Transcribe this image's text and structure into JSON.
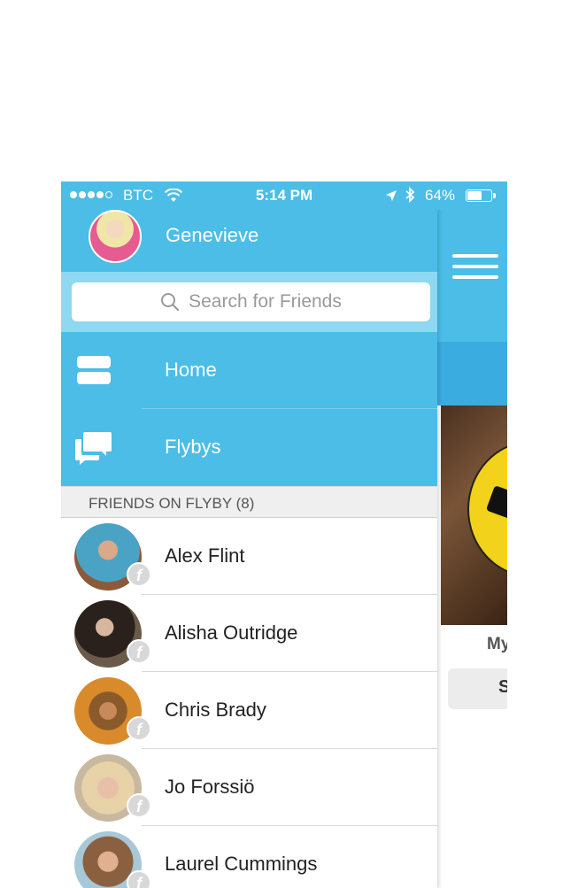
{
  "status_bar": {
    "carrier": "BTC",
    "time": "5:14 PM",
    "battery_percent": "64%",
    "battery_level": 0.64
  },
  "profile": {
    "name": "Genevieve"
  },
  "search": {
    "placeholder": "Search for Friends"
  },
  "menu": {
    "items": [
      {
        "label": "Home",
        "icon": "home-icon"
      },
      {
        "label": "Flybys",
        "icon": "chat-bubbles-icon"
      }
    ]
  },
  "friends_section": {
    "header": "FRIENDS ON FLYBY (8)",
    "friends": [
      {
        "name": "Alex Flint"
      },
      {
        "name": "Alisha Outridge"
      },
      {
        "name": "Chris Brady"
      },
      {
        "name": "Jo Forssiö"
      },
      {
        "name": "Laurel Cummings"
      }
    ]
  },
  "background_screen": {
    "caption_fragment": "My",
    "button_fragment": "S"
  },
  "colors": {
    "primary": "#4bbde7",
    "search_bg": "#8fd8f2",
    "section_bg": "#efefef"
  }
}
